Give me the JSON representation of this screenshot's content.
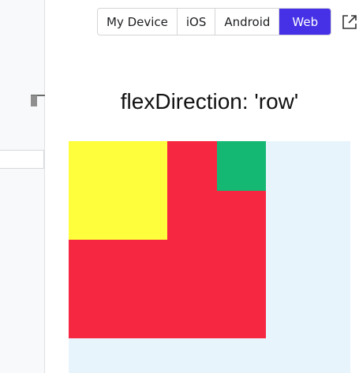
{
  "platform_tabs": [
    {
      "label": "My Device",
      "active": false
    },
    {
      "label": "iOS",
      "active": false
    },
    {
      "label": "Android",
      "active": false
    },
    {
      "label": "Web",
      "active": true
    }
  ],
  "preview": {
    "title": "flexDirection: 'row'"
  },
  "colors": {
    "accent": "#4631e6",
    "preview_background": "#e8f4fc",
    "red": "#f62741",
    "yellow": "#fefe3c",
    "green": "#14b873"
  },
  "icons": {
    "open_external": "external-link-icon"
  }
}
